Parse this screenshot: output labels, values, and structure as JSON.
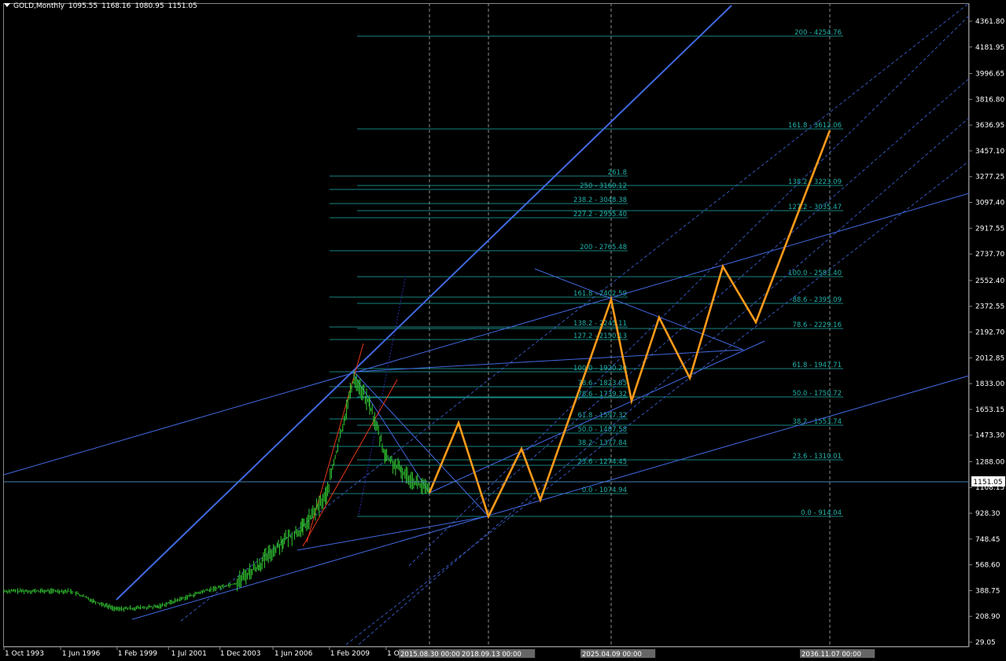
{
  "header": {
    "symbol": "GOLD,Monthly",
    "open": "1095.55",
    "high": "1168.16",
    "low": "1080.95",
    "close": "1151.05"
  },
  "colors": {
    "background": "#000000",
    "axis_text": "#ffffff",
    "price_bars": "#32cd32",
    "trend_lines": "#4169e1",
    "fib_levels": "#20b2aa",
    "forecast_path": "#ff9b1a",
    "fan_lines": "#ff3b1a",
    "grid_vlines": "#8c8c8c",
    "current_price_line": "#4682b4"
  },
  "chart_data": {
    "type": "line",
    "title": "GOLD,Monthly",
    "price_axis": {
      "ticks": [
        "4361.80",
        "4181.95",
        "3996.65",
        "3816.80",
        "3636.95",
        "3457.10",
        "3277.25",
        "3097.40",
        "2917.55",
        "2737.70",
        "2552.40",
        "2372.55",
        "2192.70",
        "2012.85",
        "1833.00",
        "1653.15",
        "1473.30",
        "1288.00",
        "1108.15",
        "928.30",
        "748.45",
        "568.60",
        "388.75",
        "208.90",
        "29.05"
      ],
      "ylim": [
        29.05,
        4361.8
      ],
      "current_price": "1151.05"
    },
    "time_axis": {
      "ticks": [
        "1 Oct 1993",
        "1 Jun 1996",
        "1 Feb 1999",
        "1 Jul 2001",
        "1 Dec 2003",
        "1 Jun 2006",
        "1 Feb 2009",
        "1 Oct 2011"
      ],
      "highlighted_labels": [
        "2015.08.30 00:00",
        "2018.09.13 00:00",
        "2025.04.09 00:00",
        "2036.11.07 00:00"
      ]
    },
    "gold_price_approx": [
      {
        "x": "1993",
        "y": 395
      },
      {
        "x": "1996",
        "y": 390
      },
      {
        "x": "1997",
        "y": 340
      },
      {
        "x": "1999",
        "y": 265
      },
      {
        "x": "2001",
        "y": 275
      },
      {
        "x": "2003",
        "y": 410
      },
      {
        "x": "2005",
        "y": 480
      },
      {
        "x": "2006",
        "y": 620
      },
      {
        "x": "2008",
        "y": 900
      },
      {
        "x": "2009",
        "y": 1000
      },
      {
        "x": "2010",
        "y": 1250
      },
      {
        "x": "2011",
        "y": 1900
      },
      {
        "x": "2012",
        "y": 1700
      },
      {
        "x": "2013",
        "y": 1350
      },
      {
        "x": "2014",
        "y": 1250
      },
      {
        "x": "2015",
        "y": 1100
      }
    ],
    "forecast_path": [
      {
        "x": "2015.08",
        "y": 1074.94
      },
      {
        "x": "2016.6",
        "y": 1530
      },
      {
        "x": "2018.09",
        "y": 920
      },
      {
        "x": "2020.0",
        "y": 1360
      },
      {
        "x": "2021.0",
        "y": 1020
      },
      {
        "x": "2025.04",
        "y": 2420
      },
      {
        "x": "2026.4",
        "y": 1730
      },
      {
        "x": "2027.6",
        "y": 2230
      },
      {
        "x": "2029.0",
        "y": 1870
      },
      {
        "x": "2031.5",
        "y": 2680
      },
      {
        "x": "2032.8",
        "y": 2240
      },
      {
        "x": "2036.11",
        "y": 3620
      }
    ],
    "fib_labels": {
      "set_high": [
        "200 - 4254.76",
        "161.8 - 3612.06",
        "138.2 - 3223.09",
        "127.2 - 3035.47",
        "100.0 - 2583.40",
        "88.6 - 2395.09",
        "78.6 - 2229.16",
        "61.8 - 1947.71",
        "50.0 - 1750.72",
        "38.2 - 1553.74",
        "23.6 - 1310.01",
        "0.0 - 914.04"
      ],
      "set_mid": [
        "261.8",
        "250 - 3160.12",
        "238.2 - 3048.38",
        "227.2 - 2955.40",
        "200 - 2765.48",
        "161.8 - 2402.59",
        "138.2 - 2245.11",
        "127.2 - 2150.13",
        "100.0 - 1920.20",
        "78.6 - 1823.85",
        "78.6 - 1739.32",
        "61.8 - 1597.32",
        "50.0 - 1487.58",
        "38.2 - 1377.84",
        "23.6 - 1274.45",
        "0.0 - 1074.94"
      ]
    },
    "grid": false,
    "legend": "none"
  }
}
